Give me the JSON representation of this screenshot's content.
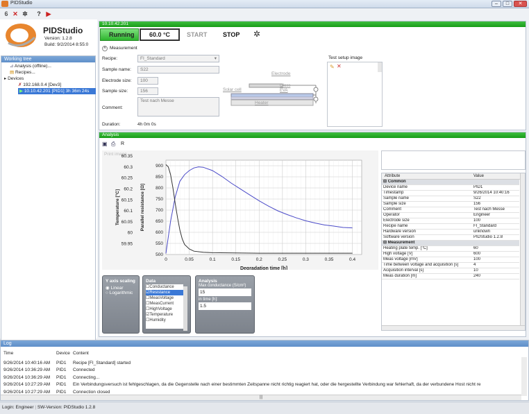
{
  "app": {
    "title": "PIDStudio",
    "name": "PIDStudio",
    "version": "Version: 1.2.8",
    "build": "Build: 9/2/2014 8:55:0"
  },
  "toolbar": {
    "icons": [
      "6",
      "✕",
      "✲",
      "?",
      "▶"
    ]
  },
  "sidebar": {
    "title": "Working tree",
    "items": [
      {
        "label": "Analysis (offline)..."
      },
      {
        "label": "Recipes..."
      },
      {
        "label": "Devices"
      },
      {
        "label": "192.168.0.4  [Dev3]"
      },
      {
        "label": "10.10.42.201  [PID1]  3h 36m 24s"
      }
    ]
  },
  "device": {
    "ip": "10.10.42.201",
    "status": "Running",
    "temperature": "60.0 °C",
    "start_label": "START",
    "stop_label": "STOP"
  },
  "measurement": {
    "title": "Measurement",
    "recipe_label": "Recipe:",
    "recipe_value": "FI_Standard",
    "sample_name_label": "Sample name:",
    "sample_name_value": "S22",
    "electrode_label": "Electrode size:",
    "electrode_value": "100",
    "sample_size_label": "Sample size:",
    "sample_size_value": "156",
    "comment_label": "Comment:",
    "comment_value": "Test nach Messe",
    "duration_label": "Duration:",
    "duration_value": "4h 0m 0s",
    "test_setup_label": "Test setup image",
    "diagram": {
      "electrode": "Electrode",
      "glass": "Glass",
      "eva": "EVA",
      "solar_cell": "Solar cell",
      "heater": "Heater"
    }
  },
  "analysis": {
    "title": "Analysis",
    "print_label": "Print image",
    "r_label": "R"
  },
  "chart_data": {
    "type": "line",
    "xlabel": "Degradation time [h]",
    "ylabel_left": "Temperature [°C]",
    "ylabel_right": "Parallel resistance [Ω]",
    "x_ticks": [
      "0",
      "0.05",
      "0.1",
      "0.15",
      "0.2",
      "0.25",
      "0.3",
      "0.35",
      "0.4"
    ],
    "temp_ticks": [
      "60.35",
      "60.3",
      "60.25",
      "60.2",
      "60.15",
      "60.1",
      "60.05",
      "60",
      "59.95"
    ],
    "res_ticks": [
      "900",
      "850",
      "800",
      "750",
      "700",
      "650",
      "600",
      "550",
      "500"
    ],
    "xlim": [
      0,
      0.42
    ],
    "res_lim": [
      500,
      925
    ],
    "series": [
      {
        "name": "Resistance",
        "color": "#4a4ac8",
        "x": [
          0,
          0.01,
          0.02,
          0.03,
          0.04,
          0.05,
          0.06,
          0.07,
          0.08,
          0.1,
          0.12,
          0.14,
          0.16,
          0.18,
          0.2,
          0.22,
          0.24,
          0.26,
          0.28,
          0.3,
          0.32,
          0.34,
          0.36,
          0.38,
          0.4
        ],
        "y": [
          505,
          650,
          760,
          830,
          860,
          878,
          890,
          895,
          893,
          878,
          852,
          822,
          795,
          768,
          742,
          718,
          697,
          680,
          665,
          652,
          642,
          633,
          628,
          622,
          620
        ]
      },
      {
        "name": "Temperature",
        "color": "#333333",
        "x": [
          0,
          0.005,
          0.01,
          0.015,
          0.02,
          0.025,
          0.03,
          0.035,
          0.04,
          0.05,
          0.06,
          0.08,
          0.1,
          0.15,
          0.2,
          0.25,
          0.3,
          0.35,
          0.4
        ],
        "y": [
          905,
          895,
          860,
          800,
          730,
          665,
          610,
          570,
          545,
          525,
          515,
          510,
          508,
          507,
          506,
          506,
          506,
          506,
          506
        ]
      }
    ]
  },
  "properties": {
    "col_attr": "Attribute",
    "col_val": "Value",
    "rows": [
      {
        "section": "Common"
      },
      {
        "a": "Device name",
        "v": "PID1"
      },
      {
        "a": "Timestamp",
        "v": "9/26/2014 10:40:16"
      },
      {
        "a": "Sample name",
        "v": "S22"
      },
      {
        "a": "Sample size",
        "v": "156"
      },
      {
        "a": "Comment",
        "v": "Test nach Messe"
      },
      {
        "a": "Operator",
        "v": "Engineer"
      },
      {
        "a": "Electrode size",
        "v": "100"
      },
      {
        "a": "Recipe name",
        "v": "FI_Standard"
      },
      {
        "a": "Hardware version",
        "v": "unknown"
      },
      {
        "a": "Software version",
        "v": "PIDStudio 1.2.8"
      },
      {
        "section": "Measurement"
      },
      {
        "a": "Heating plate temp. [°C]",
        "v": "60"
      },
      {
        "a": "High voltage [V]",
        "v": "600"
      },
      {
        "a": "Meas voltage [mV]",
        "v": "100"
      },
      {
        "a": "Time between voltage and acquisition [s]",
        "v": "4"
      },
      {
        "a": "Acquisition interval [s]",
        "v": "10"
      },
      {
        "a": "Meas duration [m]",
        "v": "240"
      }
    ]
  },
  "yaxis": {
    "title": "Y axis scaling",
    "linear": "Linear",
    "log": "Logarithmic"
  },
  "data_panel": {
    "title": "Data",
    "items": [
      {
        "label": "Conductance",
        "checked": false
      },
      {
        "label": "Resistance",
        "checked": true
      },
      {
        "label": "MeasVoltage",
        "checked": false
      },
      {
        "label": "MeasCurrent",
        "checked": false
      },
      {
        "label": "HighVoltage",
        "checked": false
      },
      {
        "label": "Temperature",
        "checked": true
      },
      {
        "label": "Humidity",
        "checked": false
      }
    ]
  },
  "analysis_panel": {
    "title": "Analysis",
    "max_label": "Max conductance (S/cm²)",
    "max_value": "15",
    "time_label": "in time [h]:",
    "time_value": "1.5"
  },
  "log": {
    "title": "Log",
    "col_time": "Time",
    "col_device": "Device",
    "col_content": "Content",
    "rows": [
      {
        "t": "9/26/2014 10:40:16 AM",
        "d": "PID1",
        "c": "Recipe [FI_Standard] started"
      },
      {
        "t": "9/26/2014 10:36:29 AM",
        "d": "PID1",
        "c": "Connected"
      },
      {
        "t": "9/26/2014 10:36:29 AM",
        "d": "PID1",
        "c": "Connecting..."
      },
      {
        "t": "9/26/2014 10:27:29 AM",
        "d": "PID1",
        "c": "Ein Verbindungsversuch ist fehlgeschlagen, da die Gegenstelle nach einer bestimmten Zeitspanne nicht richtig reagiert hat, oder die hergestellte Verbindung war fehlerhaft, da der verbundene Host nicht re"
      },
      {
        "t": "9/26/2014 10:27:29 AM",
        "d": "PID1",
        "c": "Connection closed"
      }
    ]
  },
  "statusbar": {
    "login": "Login: Engineer",
    "sw": "SW-Version: PIDStudio 1.2.8"
  }
}
